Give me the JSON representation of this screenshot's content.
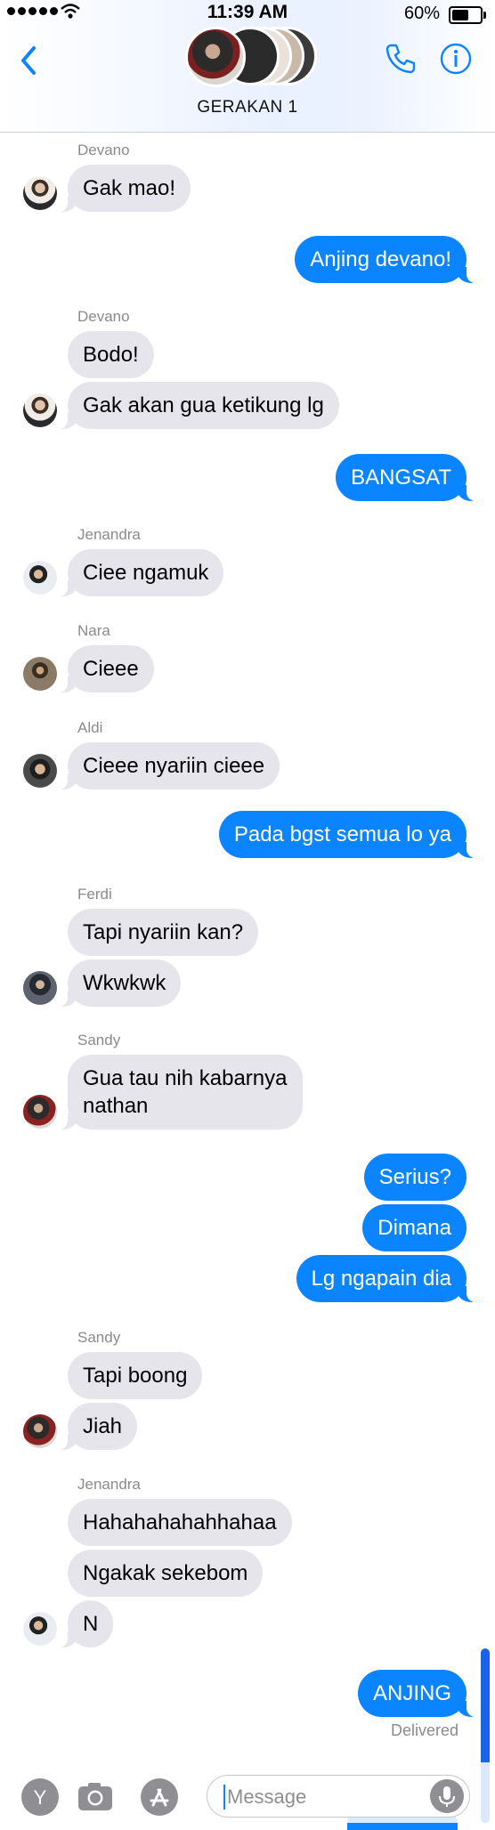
{
  "status_bar": {
    "time": "11:39 AM",
    "battery_text": "60%",
    "battery_level": 0.6
  },
  "header": {
    "group_name": "GERAKAN 1",
    "back_icon": "chevron-left-icon",
    "call_icon": "phone-icon",
    "info_icon": "info-icon"
  },
  "colors": {
    "accent": "#0b84ff",
    "incoming_bubble": "#e6e5eb",
    "muted_text": "#8a8a8f"
  },
  "messages": [
    {
      "sender": "Devano",
      "text": "Gak mao!"
    },
    {
      "text": "Anjing devano!"
    },
    {
      "sender": "Devano",
      "text": "Bodo!"
    },
    {
      "text": "Gak akan gua ketikung lg"
    },
    {
      "text": "BANGSAT"
    },
    {
      "sender": "Jenandra",
      "text": "Ciee ngamuk"
    },
    {
      "sender": "Nara",
      "text": "Cieee"
    },
    {
      "sender": "Aldi",
      "text": "Cieee nyariin cieee"
    },
    {
      "text": "Pada bgst semua lo ya"
    },
    {
      "sender": "Ferdi",
      "text": "Tapi nyariin kan?"
    },
    {
      "text": "Wkwkwk"
    },
    {
      "sender": "Sandy",
      "line1": "Gua tau nih kabarnya",
      "line2": "nathan"
    },
    {
      "text": "Serius?"
    },
    {
      "text": "Dimana"
    },
    {
      "text": "Lg ngapain dia"
    },
    {
      "sender": "Sandy",
      "text": "Tapi boong"
    },
    {
      "text": "Jiah"
    },
    {
      "sender": "Jenandra",
      "text": "Hahahahahahhahaa"
    },
    {
      "text": "Ngakak sekebom"
    },
    {
      "text": "N"
    },
    {
      "text": "ANJING"
    }
  ],
  "delivered_label": "Delivered",
  "input_bar": {
    "placeholder": "Message",
    "value": "",
    "apps_icon": "y-app-icon",
    "camera_icon": "camera-icon",
    "store_icon": "app-store-icon",
    "mic_icon": "microphone-icon"
  }
}
